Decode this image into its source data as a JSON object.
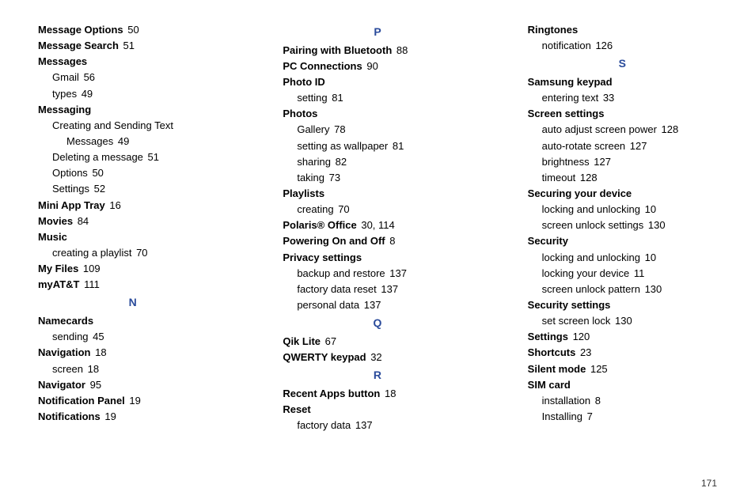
{
  "page_number": "171",
  "columns": [
    [
      {
        "type": "entry",
        "term": "Message Options",
        "page": "50"
      },
      {
        "type": "entry",
        "term": "Message Search",
        "page": "51"
      },
      {
        "type": "entry",
        "term": "Messages"
      },
      {
        "type": "sub1",
        "text": "Gmail",
        "page": "56"
      },
      {
        "type": "sub1",
        "text": "types",
        "page": "49"
      },
      {
        "type": "entry",
        "term": "Messaging"
      },
      {
        "type": "sub1",
        "text": "Creating and Sending Text"
      },
      {
        "type": "sub2",
        "text": "Messages",
        "page": "49"
      },
      {
        "type": "sub1",
        "text": "Deleting a message",
        "page": "51"
      },
      {
        "type": "sub1",
        "text": "Options",
        "page": "50"
      },
      {
        "type": "sub1",
        "text": "Settings",
        "page": "52"
      },
      {
        "type": "entry",
        "term": "Mini App Tray",
        "page": "16"
      },
      {
        "type": "entry",
        "term": "Movies",
        "page": "84"
      },
      {
        "type": "entry",
        "term": "Music"
      },
      {
        "type": "sub1",
        "text": "creating a playlist",
        "page": "70"
      },
      {
        "type": "entry",
        "term": "My Files",
        "page": "109"
      },
      {
        "type": "entry",
        "term": "myAT&T",
        "page": "111"
      },
      {
        "type": "letter",
        "text": "N"
      },
      {
        "type": "entry",
        "term": "Namecards"
      },
      {
        "type": "sub1",
        "text": "sending",
        "page": "45"
      },
      {
        "type": "entry",
        "term": "Navigation",
        "page": "18"
      },
      {
        "type": "sub1",
        "text": "screen",
        "page": "18"
      },
      {
        "type": "entry",
        "term": "Navigator",
        "page": "95"
      },
      {
        "type": "entry",
        "term": "Notification Panel",
        "page": "19"
      },
      {
        "type": "entry",
        "term": "Notifications",
        "page": "19"
      }
    ],
    [
      {
        "type": "letter",
        "text": "P"
      },
      {
        "type": "entry",
        "term": "Pairing with Bluetooth",
        "page": "88"
      },
      {
        "type": "entry",
        "term": "PC Connections",
        "page": "90"
      },
      {
        "type": "entry",
        "term": "Photo ID"
      },
      {
        "type": "sub1",
        "text": "setting",
        "page": "81"
      },
      {
        "type": "entry",
        "term": "Photos"
      },
      {
        "type": "sub1",
        "text": "Gallery",
        "page": "78"
      },
      {
        "type": "sub1",
        "text": "setting as wallpaper",
        "page": "81"
      },
      {
        "type": "sub1",
        "text": "sharing",
        "page": "82"
      },
      {
        "type": "sub1",
        "text": "taking",
        "page": "73"
      },
      {
        "type": "entry",
        "term": "Playlists"
      },
      {
        "type": "sub1",
        "text": "creating",
        "page": "70"
      },
      {
        "type": "entry",
        "term": "Polaris® Office",
        "page": "30, 114"
      },
      {
        "type": "entry",
        "term": "Powering On and Off",
        "page": "8"
      },
      {
        "type": "entry",
        "term": "Privacy settings"
      },
      {
        "type": "sub1",
        "text": "backup and restore",
        "page": "137"
      },
      {
        "type": "sub1",
        "text": "factory data reset",
        "page": "137"
      },
      {
        "type": "sub1",
        "text": "personal data",
        "page": "137"
      },
      {
        "type": "letter",
        "text": "Q"
      },
      {
        "type": "entry",
        "term": "Qik Lite",
        "page": "67"
      },
      {
        "type": "entry",
        "term": "QWERTY keypad",
        "page": "32"
      },
      {
        "type": "letter",
        "text": "R"
      },
      {
        "type": "entry",
        "term": "Recent Apps button",
        "page": "18"
      },
      {
        "type": "entry",
        "term": "Reset"
      },
      {
        "type": "sub1",
        "text": "factory data",
        "page": "137"
      }
    ],
    [
      {
        "type": "entry",
        "term": "Ringtones"
      },
      {
        "type": "sub1",
        "text": "notification",
        "page": "126"
      },
      {
        "type": "letter",
        "text": "S"
      },
      {
        "type": "entry",
        "term": "Samsung keypad"
      },
      {
        "type": "sub1",
        "text": "entering text",
        "page": "33"
      },
      {
        "type": "entry",
        "term": "Screen settings"
      },
      {
        "type": "sub1",
        "text": "auto adjust screen power",
        "page": "128"
      },
      {
        "type": "sub1",
        "text": "auto-rotate screen",
        "page": "127"
      },
      {
        "type": "sub1",
        "text": "brightness",
        "page": "127"
      },
      {
        "type": "sub1",
        "text": "timeout",
        "page": "128"
      },
      {
        "type": "entry",
        "term": "Securing your device"
      },
      {
        "type": "sub1",
        "text": "locking and unlocking",
        "page": "10"
      },
      {
        "type": "sub1",
        "text": "screen unlock settings",
        "page": "130"
      },
      {
        "type": "entry",
        "term": "Security"
      },
      {
        "type": "sub1",
        "text": "locking and unlocking",
        "page": "10"
      },
      {
        "type": "sub1",
        "text": "locking your device",
        "page": "11"
      },
      {
        "type": "sub1",
        "text": "screen unlock pattern",
        "page": "130"
      },
      {
        "type": "entry",
        "term": "Security settings"
      },
      {
        "type": "sub1",
        "text": "set screen lock",
        "page": "130"
      },
      {
        "type": "entry",
        "term": "Settings",
        "page": "120"
      },
      {
        "type": "entry",
        "term": "Shortcuts",
        "page": "23"
      },
      {
        "type": "entry",
        "term": "Silent mode",
        "page": "125"
      },
      {
        "type": "entry",
        "term": "SIM card"
      },
      {
        "type": "sub1",
        "text": "installation",
        "page": "8"
      },
      {
        "type": "sub1",
        "text": "Installing",
        "page": "7"
      }
    ]
  ]
}
